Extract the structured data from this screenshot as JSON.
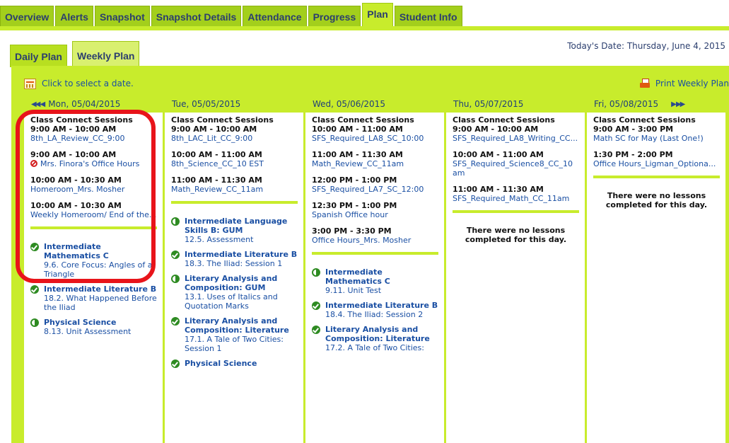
{
  "top_tabs": [
    {
      "label": "Overview",
      "active": false
    },
    {
      "label": "Alerts",
      "active": false
    },
    {
      "label": "Snapshot",
      "active": false
    },
    {
      "label": "Snapshot Details",
      "active": false
    },
    {
      "label": "Attendance",
      "active": false
    },
    {
      "label": "Progress",
      "active": false
    },
    {
      "label": "Plan",
      "active": true
    },
    {
      "label": "Student Info",
      "active": false
    }
  ],
  "sub_tabs": {
    "daily": "Daily Plan",
    "weekly": "Weekly Plan"
  },
  "today_label": "Today's Date: Thursday, June 4, 2015",
  "toolbar": {
    "select_date": "Click to select a date.",
    "print": "Print Weekly Plan"
  },
  "days": [
    {
      "header": "Mon, 05/04/2015",
      "sessions_title": "Class Connect Sessions",
      "sessions": [
        {
          "time": "9:00 AM - 10:00 AM",
          "name": "8th_LA_Review_CC_9:00",
          "cancelled": false
        },
        {
          "time": "9:00 AM - 10:00 AM",
          "name": "Mrs. Finora's Office Hours",
          "cancelled": true
        },
        {
          "time": "10:00 AM - 10:30 AM",
          "name": "Homeroom_Mrs. Mosher",
          "cancelled": false
        },
        {
          "time": "10:00 AM - 10:30 AM",
          "name": "Weekly Homeroom/ End of the...",
          "cancelled": false
        }
      ],
      "lessons": [
        {
          "status": "done",
          "course": "Intermediate Mathematics C",
          "detail": "9.6. Core Focus: Angles of a Triangle"
        },
        {
          "status": "done",
          "course": "Intermediate Literature B",
          "detail": "18.2. What Happened Before the Iliad"
        },
        {
          "status": "half",
          "course": "Physical Science",
          "detail": "8.13. Unit Assessment"
        }
      ],
      "empty_note": ""
    },
    {
      "header": "Tue, 05/05/2015",
      "sessions_title": "Class Connect Sessions",
      "sessions": [
        {
          "time": "9:00 AM - 10:00 AM",
          "name": "8th_LAC_Lit_CC_9:00",
          "cancelled": false
        },
        {
          "time": "10:00 AM - 11:00 AM",
          "name": "8th_Science_CC_10 EST",
          "cancelled": false
        },
        {
          "time": "11:00 AM - 11:30 AM",
          "name": "Math_Review_CC_11am",
          "cancelled": false
        }
      ],
      "lessons": [
        {
          "status": "half",
          "course": "Intermediate Language Skills B: GUM",
          "detail": "12.5. Assessment"
        },
        {
          "status": "done",
          "course": "Intermediate Literature B",
          "detail": "18.3. The Iliad: Session 1"
        },
        {
          "status": "half",
          "course": "Literary Analysis and Composition: GUM",
          "detail": "13.1. Uses of Italics and Quotation Marks"
        },
        {
          "status": "done",
          "course": "Literary Analysis and Composition: Literature",
          "detail": "17.1. A Tale of Two Cities: Session 1"
        },
        {
          "status": "done",
          "course": "Physical Science",
          "detail": ""
        }
      ],
      "empty_note": ""
    },
    {
      "header": "Wed, 05/06/2015",
      "sessions_title": "Class Connect Sessions",
      "sessions": [
        {
          "time": "10:00 AM - 11:00 AM",
          "name": "SFS_Required_LA8_SC_10:00",
          "cancelled": false
        },
        {
          "time": "11:00 AM - 11:30 AM",
          "name": "Math_Review_CC_11am",
          "cancelled": false
        },
        {
          "time": "12:00 PM - 1:00 PM",
          "name": "SFS_Required_LA7_SC_12:00",
          "cancelled": false
        },
        {
          "time": "12:30 PM - 1:00 PM",
          "name": "Spanish Office hour",
          "cancelled": false
        },
        {
          "time": "3:00 PM - 3:30 PM",
          "name": "Office Hours_Mrs. Mosher",
          "cancelled": false
        }
      ],
      "lessons": [
        {
          "status": "half",
          "course": "Intermediate Mathematics C",
          "detail": "9.11. Unit Test"
        },
        {
          "status": "done",
          "course": "Intermediate Literature B",
          "detail": "18.4. The Iliad: Session 2"
        },
        {
          "status": "done",
          "course": "Literary Analysis and Composition: Literature",
          "detail": "17.2. A Tale of Two Cities:"
        }
      ],
      "empty_note": ""
    },
    {
      "header": "Thu, 05/07/2015",
      "sessions_title": "Class Connect Sessions",
      "sessions": [
        {
          "time": "9:00 AM - 10:00 AM",
          "name": "SFS_Required_LA8_Writing_CC...",
          "cancelled": false
        },
        {
          "time": "10:00 AM - 11:00 AM",
          "name": "SFS_Required_Science8_CC_10 am",
          "cancelled": false
        },
        {
          "time": "11:00 AM - 11:30 AM",
          "name": "SFS_Required_Math_CC_11am",
          "cancelled": false
        }
      ],
      "lessons": [],
      "empty_note": "There were no lessons completed for this day."
    },
    {
      "header": "Fri, 05/08/2015",
      "sessions_title": "Class Connect Sessions",
      "sessions": [
        {
          "time": "9:00 AM - 3:00 PM",
          "name": "Math SC for May (Last One!)",
          "cancelled": false
        },
        {
          "time": "1:30 PM - 2:00 PM",
          "name": "Office Hours_Ligman_Optiona...",
          "cancelled": false
        }
      ],
      "lessons": [],
      "empty_note": "There were no lessons completed for this day."
    }
  ]
}
